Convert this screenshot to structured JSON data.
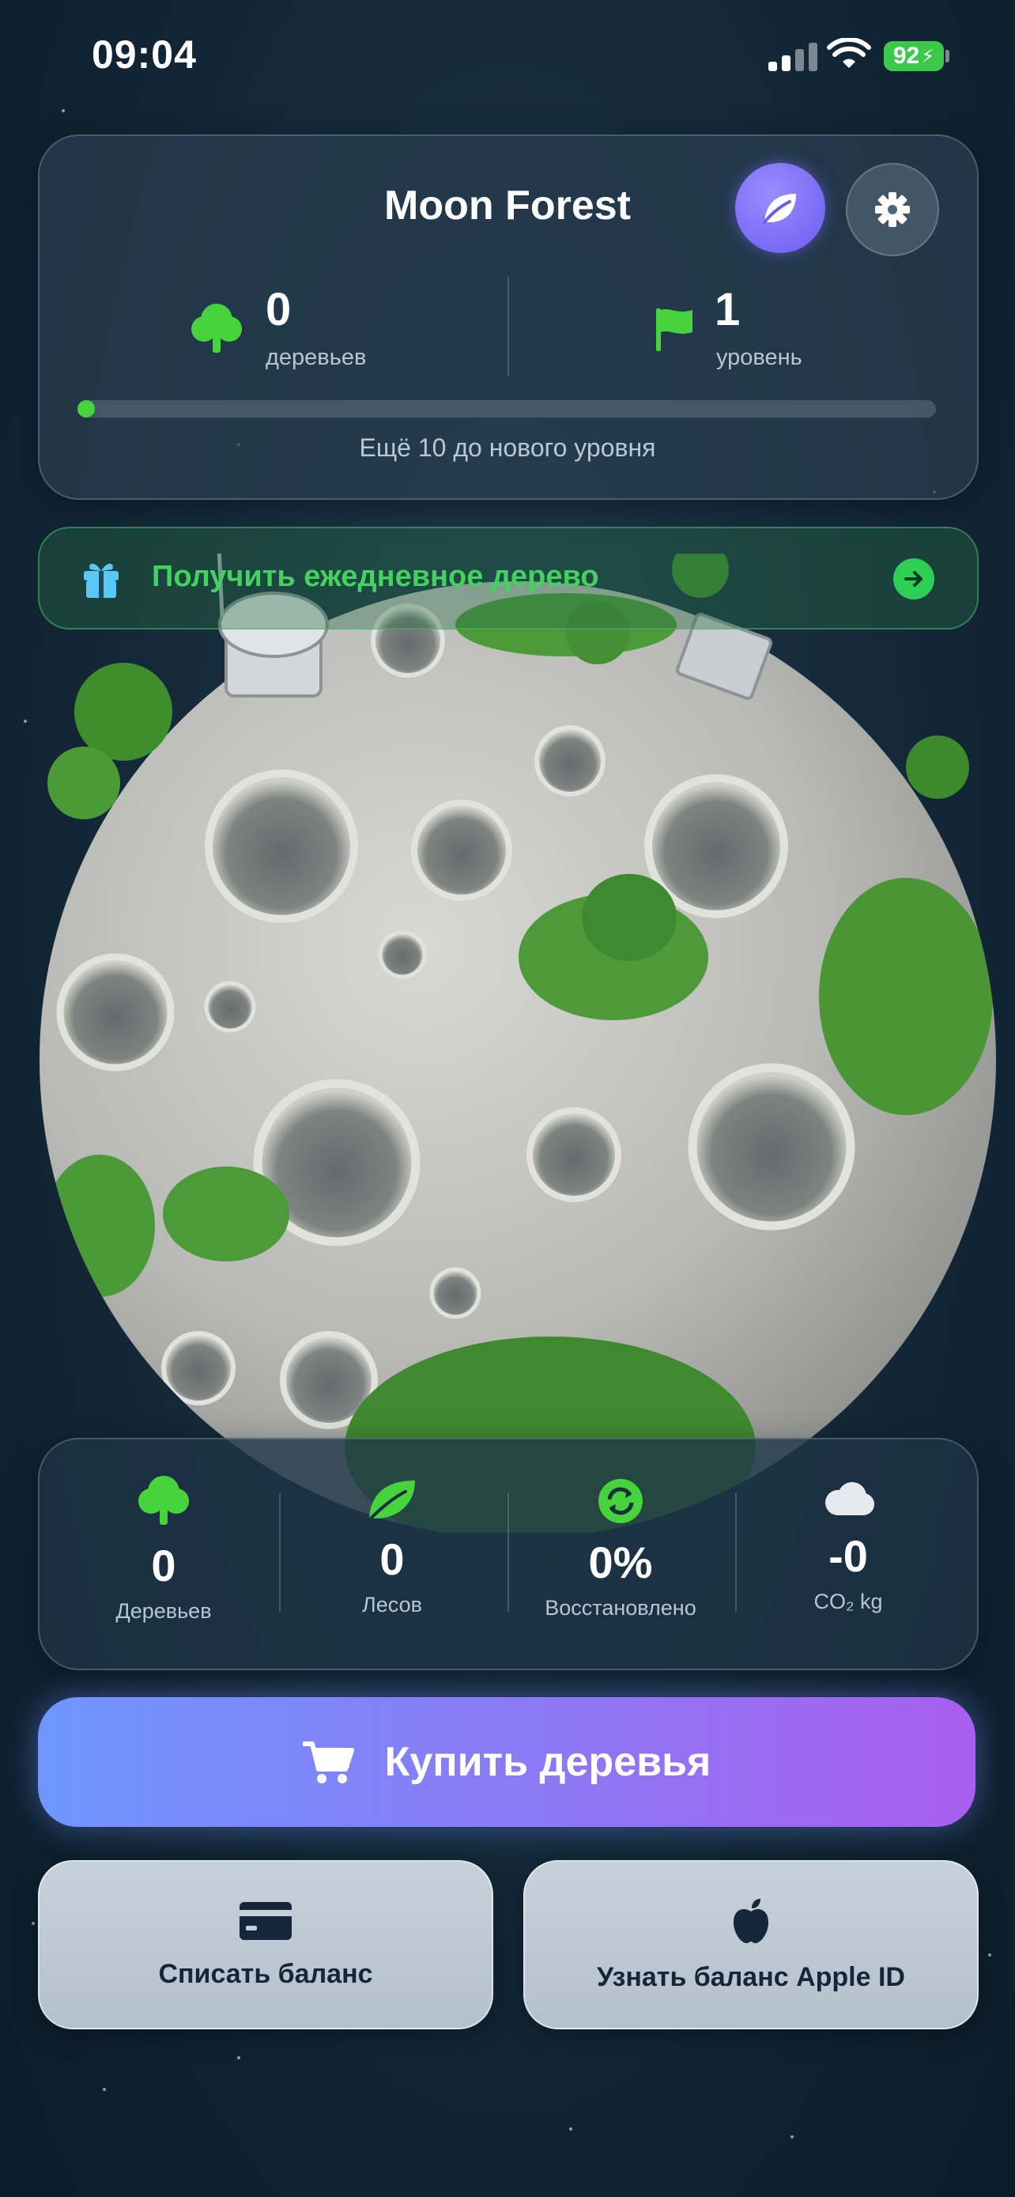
{
  "status_bar": {
    "time": "09:04",
    "battery": "92"
  },
  "header": {
    "title": "Moon Forest",
    "trees_value": "0",
    "trees_label": "деревьев",
    "level_value": "1",
    "level_label": "уровень",
    "progress_fraction": 0.02,
    "progress_text": "Ещё 10 до нового уровня"
  },
  "daily": {
    "label": "Получить ежедневное дерево"
  },
  "stats": [
    {
      "value": "0",
      "label": "Деревьев",
      "icon": "tree-icon"
    },
    {
      "value": "0",
      "label": "Лесов",
      "icon": "leaf-icon"
    },
    {
      "value": "0%",
      "label": "Восстановлено",
      "icon": "restore-icon"
    },
    {
      "value": "-0",
      "label": "CO₂ kg",
      "icon": "cloud-icon"
    }
  ],
  "actions": {
    "buy_label": "Купить деревья",
    "charge_label": "Списать баланс",
    "apple_label": "Узнать баланс Apple ID"
  },
  "colors": {
    "accent_green": "#47d33b",
    "buy_gradient_start": "#6f96ff",
    "buy_gradient_end": "#a85ef0"
  }
}
